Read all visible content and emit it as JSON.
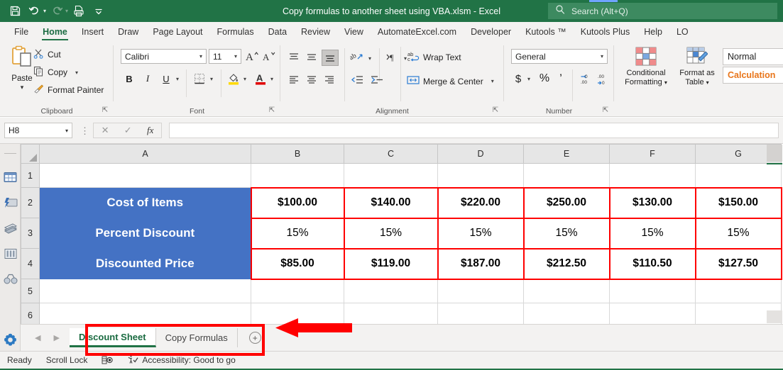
{
  "titlebar": {
    "document_title": "Copy formulas to another sheet using VBA.xlsm  -  Excel",
    "qat": [
      {
        "name": "save",
        "icon": "save-icon"
      },
      {
        "name": "undo",
        "icon": "undo-icon"
      },
      {
        "name": "redo",
        "icon": "redo-icon"
      },
      {
        "name": "quick-print",
        "icon": "print-icon"
      },
      {
        "name": "customize-qat",
        "icon": "chevron-down-icon"
      }
    ],
    "search_placeholder": "Search (Alt+Q)",
    "search_icon": "search-icon",
    "accent_green": "#217346"
  },
  "ribbon_tabs": [
    {
      "label": "File",
      "active": false
    },
    {
      "label": "Home",
      "active": true
    },
    {
      "label": "Insert",
      "active": false
    },
    {
      "label": "Draw",
      "active": false
    },
    {
      "label": "Page Layout",
      "active": false
    },
    {
      "label": "Formulas",
      "active": false
    },
    {
      "label": "Data",
      "active": false
    },
    {
      "label": "Review",
      "active": false
    },
    {
      "label": "View",
      "active": false
    },
    {
      "label": "AutomateExcel.com",
      "active": false
    },
    {
      "label": "Developer",
      "active": false
    },
    {
      "label": "Kutools ™",
      "active": false
    },
    {
      "label": "Kutools Plus",
      "active": false
    },
    {
      "label": "Help",
      "active": false
    },
    {
      "label": "LO",
      "active": false
    }
  ],
  "ribbon": {
    "clipboard": {
      "group_label": "Clipboard",
      "paste_label": "Paste",
      "cut_label": "Cut",
      "copy_label": "Copy",
      "format_painter_label": "Format Painter"
    },
    "font": {
      "group_label": "Font",
      "font_name": "Calibri",
      "font_size": "11",
      "grow_font": "A",
      "shrink_font": "A",
      "bold": "B",
      "italic": "I",
      "underline": "U",
      "borders_icon": "borders-icon",
      "fill_color_icon": "fill-color-icon",
      "font_color_icon": "font-color-icon",
      "highlight_color": "#ffd900",
      "font_color": "#e00000"
    },
    "alignment": {
      "group_label": "Alignment",
      "wrap_text_label": "Wrap Text",
      "merge_center_label": "Merge & Center",
      "orientation_icon": "orientation-icon",
      "indent_icon": "indent-icon"
    },
    "number": {
      "group_label": "Number",
      "format_value": "General",
      "accounting": "$",
      "percent": "%",
      "comma": "’",
      "decrease_decimal": "decrease-decimal-icon",
      "increase_decimal": "increase-decimal-icon"
    },
    "styles": {
      "conditional_formatting_label": "Conditional\nFormatting",
      "conditional_formatting_line1": "Conditional",
      "conditional_formatting_line2": "Formatting",
      "format_as_table_line1": "Format as",
      "format_as_table_line2": "Table",
      "style_normal": "Normal",
      "style_calculation": "Calculation",
      "calculation_color": "#e8751a"
    }
  },
  "formula_bar": {
    "name_box_value": "H8",
    "cancel_icon": "close-icon",
    "enter_icon": "check-icon",
    "function_icon": "fx-icon",
    "formula_value": ""
  },
  "sidebar_icons": [
    {
      "name": "kutools-table-icon"
    },
    {
      "name": "kutools-snapshot-icon"
    },
    {
      "name": "kutools-print-icon"
    },
    {
      "name": "kutools-columns-icon"
    },
    {
      "name": "kutools-find-icon"
    },
    {
      "name": "kutools-settings-icon"
    }
  ],
  "sheet": {
    "column_headers": [
      "A",
      "B",
      "C",
      "D",
      "E",
      "F",
      "G"
    ],
    "row_headers": [
      "1",
      "2",
      "3",
      "4",
      "5",
      "6"
    ],
    "header_fill": "#4472c4",
    "data_border": "#ff0000",
    "rows": [
      {
        "row": "1",
        "label": "",
        "values": [
          "",
          "",
          "",
          "",
          "",
          ""
        ]
      },
      {
        "row": "2",
        "label": "Cost of Items",
        "values": [
          "$100.00",
          "$140.00",
          "$220.00",
          "$250.00",
          "$130.00",
          "$150.00"
        ],
        "bold": true
      },
      {
        "row": "3",
        "label": "Percent Discount",
        "values": [
          "15%",
          "15%",
          "15%",
          "15%",
          "15%",
          "15%"
        ],
        "bold": false
      },
      {
        "row": "4",
        "label": "Discounted Price",
        "values": [
          "$85.00",
          "$119.00",
          "$187.00",
          "$212.50",
          "$110.50",
          "$127.50"
        ],
        "bold": true
      },
      {
        "row": "5",
        "label": "",
        "values": [
          "",
          "",
          "",
          "",
          "",
          ""
        ]
      },
      {
        "row": "6",
        "label": "",
        "values": [
          "",
          "",
          "",
          "",
          "",
          ""
        ]
      }
    ]
  },
  "sheet_tabs": {
    "prev_icon": "chevron-left-icon",
    "next_icon": "chevron-right-icon",
    "tabs": [
      {
        "label": "Discount Sheet",
        "active": true
      },
      {
        "label": "Copy Formulas",
        "active": false
      }
    ],
    "add_sheet_label": "+"
  },
  "status_bar": {
    "mode": "Ready",
    "scroll_lock": "Scroll Lock",
    "recording_icon": "macro-record-icon",
    "accessibility": "Accessibility: Good to go",
    "accessibility_icon": "accessibility-icon"
  },
  "annotation": {
    "highlight_color": "#ff0000",
    "arrow_name": "red-arrow-pointing-left",
    "box_name": "red-highlight-box-around-sheet-tabs"
  }
}
